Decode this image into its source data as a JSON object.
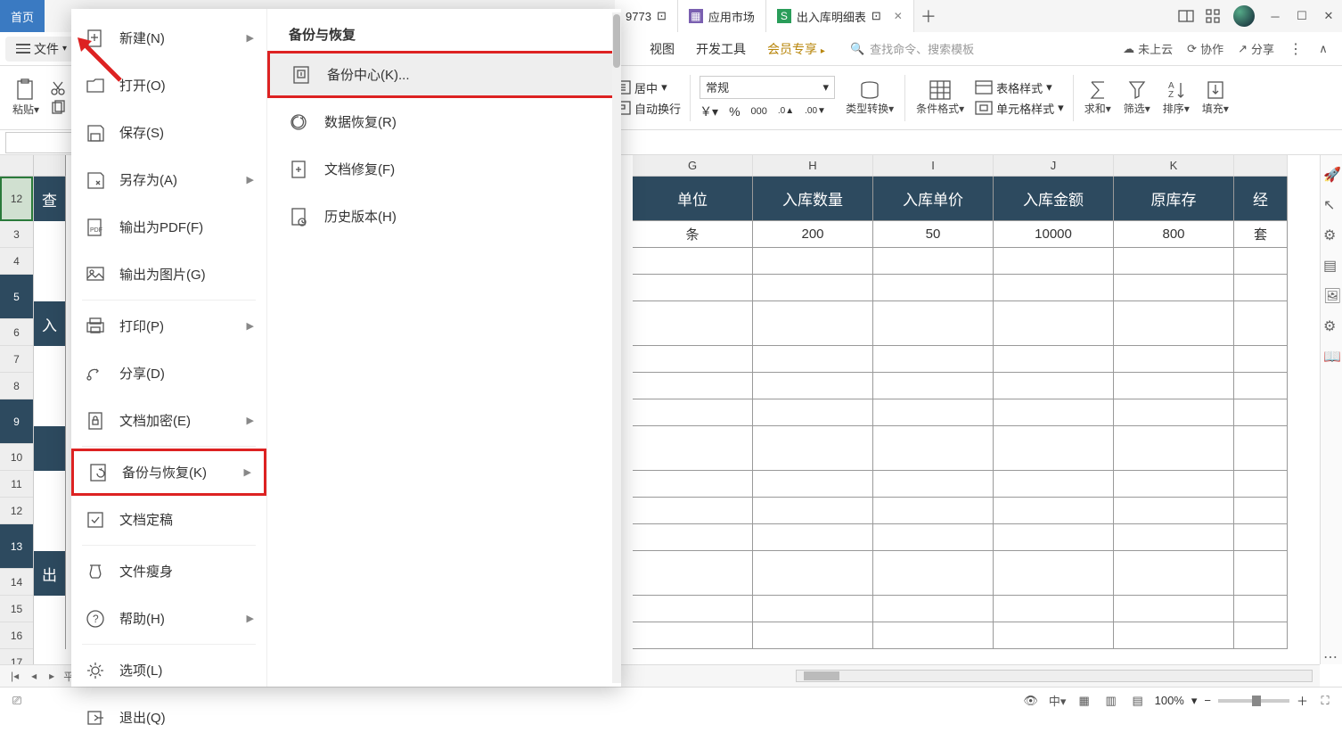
{
  "titlebar": {
    "home": "首页",
    "tab1_partial": "9773",
    "tab2": "应用市场",
    "tab3": "出入库明细表",
    "plus": "＋"
  },
  "menubar": {
    "file": "文件",
    "ribbon_tabs": [
      "视图",
      "开发工具",
      "会员专享"
    ],
    "search_placeholder": "查找命令、搜索模板",
    "cloud": "未上云",
    "collab": "协作",
    "share": "分享"
  },
  "ribbon": {
    "paste": "粘贴",
    "center": "居中",
    "wrap": "自动换行",
    "number_format": "常规",
    "type_conv": "类型转换",
    "cond_fmt": "条件格式",
    "table_style": "表格样式",
    "cell_style": "单元格样式",
    "sum": "求和",
    "filter": "筛选",
    "sort": "排序",
    "fill": "填充"
  },
  "file_menu": {
    "items": [
      {
        "label": "新建(N)",
        "arrow": true
      },
      {
        "label": "打开(O)"
      },
      {
        "label": "保存(S)"
      },
      {
        "label": "另存为(A)",
        "arrow": true
      },
      {
        "label": "输出为PDF(F)"
      },
      {
        "label": "输出为图片(G)"
      },
      {
        "label": "打印(P)",
        "arrow": true
      },
      {
        "label": "分享(D)"
      },
      {
        "label": "文档加密(E)",
        "arrow": true
      },
      {
        "label": "备份与恢复(K)",
        "arrow": true,
        "highlighted": true
      },
      {
        "label": "文档定稿"
      },
      {
        "label": "文件瘦身"
      },
      {
        "label": "帮助(H)",
        "arrow": true
      },
      {
        "label": "选项(L)"
      },
      {
        "label": "退出(Q)"
      }
    ],
    "sub_title": "备份与恢复",
    "sub_items": [
      {
        "label": "备份中心(K)...",
        "highlighted": true,
        "sel": true
      },
      {
        "label": "数据恢复(R)"
      },
      {
        "label": "文档修复(F)"
      },
      {
        "label": "历史版本(H)"
      }
    ]
  },
  "hidden_col_hdr1": "查",
  "hidden_col_hdr2": "入",
  "hidden_col_hdr3": "出",
  "columns": [
    "G",
    "H",
    "I",
    "J",
    "K"
  ],
  "headers": {
    "G": "单位",
    "H": "入库数量",
    "I": "入库单价",
    "J": "入库金额",
    "K": "原库存",
    "L": "经"
  },
  "data_row": {
    "G": "条",
    "H": "200",
    "I": "50",
    "J": "10000",
    "K": "800",
    "L": "套"
  },
  "row_nums": [
    "1",
    "2",
    "3",
    "4",
    "5",
    "6",
    "7",
    "8",
    "9",
    "10",
    "11",
    "12",
    "13",
    "14",
    "15",
    "16",
    "17"
  ],
  "statusbar": {
    "zoom": "100%",
    "sheet_label": "平"
  }
}
